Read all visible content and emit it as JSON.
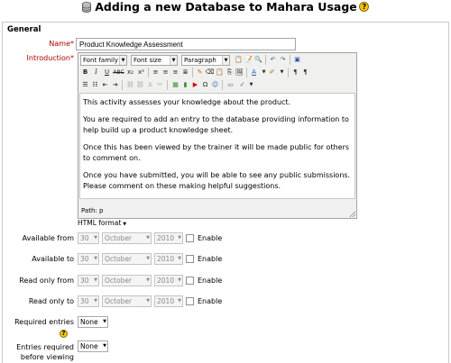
{
  "page": {
    "title": "Adding a new Database to Mahara Usage",
    "help_icon": "help-icon",
    "database_icon": "database-icon"
  },
  "section": {
    "legend": "General"
  },
  "name_field": {
    "label": "Name",
    "required_mark": "*",
    "value": "Product Knowledge Assessment"
  },
  "introduction": {
    "label": "Introduction",
    "required_mark": "*",
    "toolbar": {
      "font_family": "Font family",
      "font_size": "Font size",
      "format": "Paragraph",
      "buttons_row2": [
        "B",
        "I",
        "U",
        "ABC",
        "x₂",
        "x²"
      ]
    },
    "content": [
      "This activity assesses your knowledge about the product.",
      "You are required to add an entry to the database providing information to help build up a product knowledge sheet.",
      "Once this has been viewed by the trainer it will be made public for others to comment on.",
      "Once you have submitted, you will be able to see any public submissions. Please comment on these making helpful suggestions."
    ],
    "path": "Path: p",
    "format_select": "HTML format"
  },
  "date_rows": [
    {
      "label": "Available from",
      "day": "30",
      "month": "October",
      "year": "2010",
      "enable": "Enable"
    },
    {
      "label": "Available to",
      "day": "30",
      "month": "October",
      "year": "2010",
      "enable": "Enable"
    },
    {
      "label": "Read only from",
      "day": "30",
      "month": "October",
      "year": "2010",
      "enable": "Enable"
    },
    {
      "label": "Read only to",
      "day": "30",
      "month": "October",
      "year": "2010",
      "enable": "Enable"
    }
  ],
  "required_entries": {
    "label": "Required entries",
    "value": "None"
  },
  "entries_before_viewing": {
    "label_line1": "Entries required",
    "label_line2": "before viewing",
    "value": "None"
  },
  "colors": {
    "required_label": "#aa0000",
    "border": "#c9c9c9",
    "help": "#f5c400"
  }
}
